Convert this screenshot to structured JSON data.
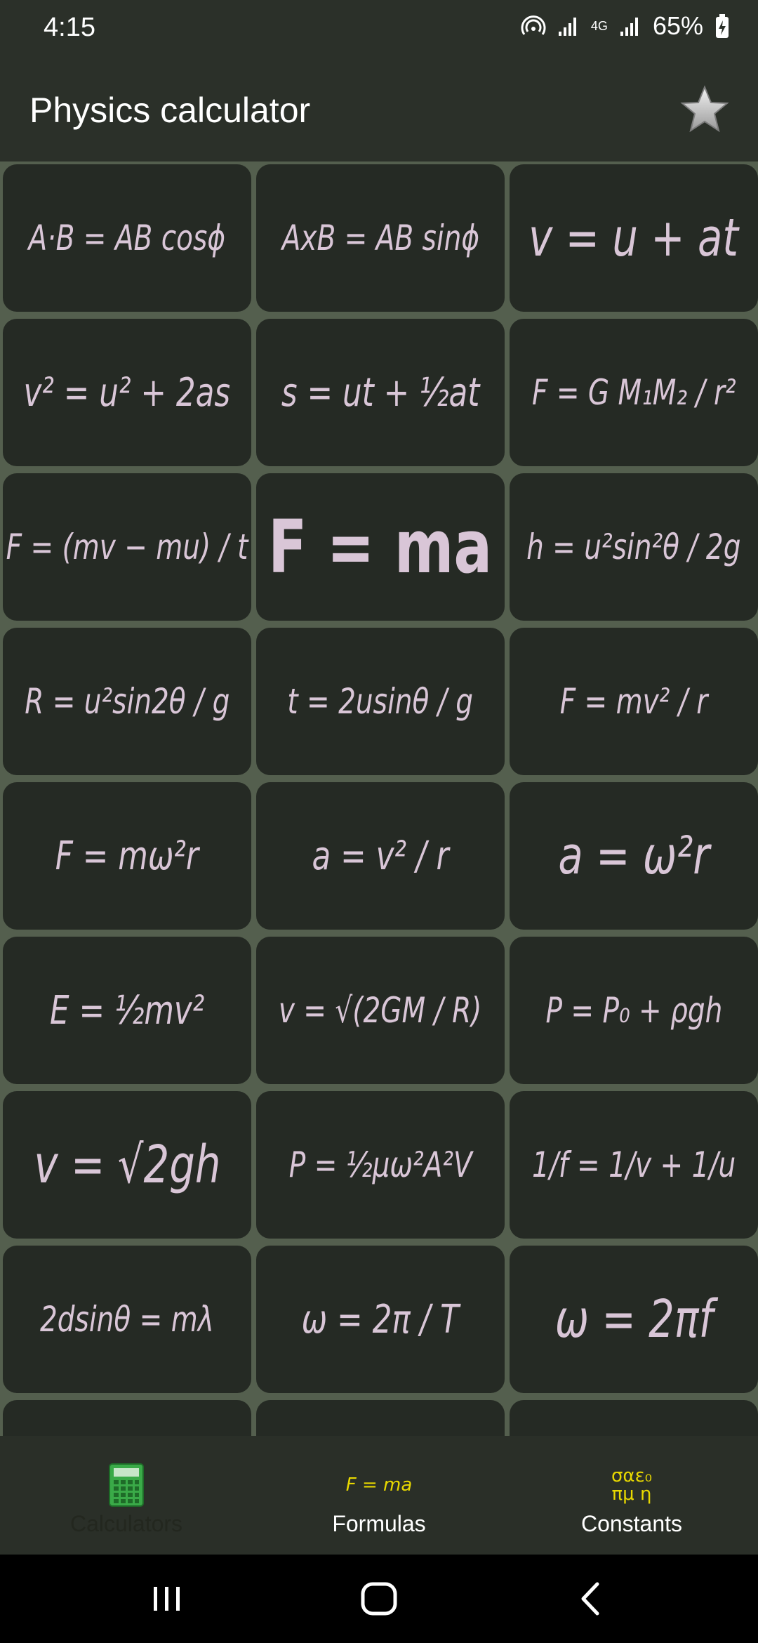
{
  "status_bar": {
    "time": "4:15",
    "battery": "65%",
    "network": "4G",
    "icons": [
      "hotspot-icon",
      "signal-icon",
      "network-4g-icon",
      "signal-icon",
      "battery-charging-icon"
    ]
  },
  "app_bar": {
    "title": "Physics calculator",
    "favorite_icon": "star-icon"
  },
  "formulas": [
    {
      "text": "A·B = AB cosϕ",
      "size": "sm"
    },
    {
      "text": "AxB = AB sinϕ",
      "size": "sm"
    },
    {
      "text": "v = u + at",
      "size": "lg"
    },
    {
      "text": "v² = u² + 2as",
      "size": "md"
    },
    {
      "text": "s = ut + ½at",
      "size": "md"
    },
    {
      "text": "F = G M₁M₂ / r²",
      "size": "sm"
    },
    {
      "text": "F = (mv − mu) / t",
      "size": "sm"
    },
    {
      "text": "F = ma",
      "size": "xl"
    },
    {
      "text": "h = u²sin²θ / 2g",
      "size": "sm"
    },
    {
      "text": "R = u²sin2θ / g",
      "size": "sm"
    },
    {
      "text": "t = 2usinθ / g",
      "size": "sm"
    },
    {
      "text": "F = mv² / r",
      "size": "sm"
    },
    {
      "text": "F = mω²r",
      "size": "md"
    },
    {
      "text": "a = v² / r",
      "size": "md"
    },
    {
      "text": "a = ω²r",
      "size": "lg"
    },
    {
      "text": "E = ½mv²",
      "size": "md"
    },
    {
      "text": "v = √(2GM / R)",
      "size": "sm"
    },
    {
      "text": "P = P₀ + ρgh",
      "size": "sm"
    },
    {
      "text": "v = √2gh",
      "size": "lg"
    },
    {
      "text": "P = ½μω²A²V",
      "size": "sm"
    },
    {
      "text": "1/f = 1/v + 1/u",
      "size": "sm"
    },
    {
      "text": "2dsinθ = mλ",
      "size": "sm"
    },
    {
      "text": "ω = 2π / T",
      "size": "md"
    },
    {
      "text": "ω = 2πf",
      "size": "lg"
    },
    {
      "text": "",
      "size": "sm"
    },
    {
      "text": "",
      "size": "sm"
    },
    {
      "text": "",
      "size": "sm"
    }
  ],
  "bottom_nav": {
    "items": [
      {
        "label": "Calculators",
        "icon": "calculator-icon",
        "active": true
      },
      {
        "label": "Formulas",
        "icon": "formulas-icon",
        "glyph": "F = ma",
        "active": false
      },
      {
        "label": "Constants",
        "icon": "constants-icon",
        "glyph_line1": "σαε₀",
        "glyph_line2": "πμ η",
        "active": false
      }
    ]
  },
  "system_nav": {
    "icons": [
      "recent-apps-icon",
      "home-icon",
      "back-icon"
    ]
  },
  "colors": {
    "background": "#2a2f28",
    "grid_background": "#545f4e",
    "card": "#252a24",
    "formula_text": "#d9c6d7",
    "accent_yellow": "#e8d800",
    "calculator_green": "#3aaa48"
  }
}
